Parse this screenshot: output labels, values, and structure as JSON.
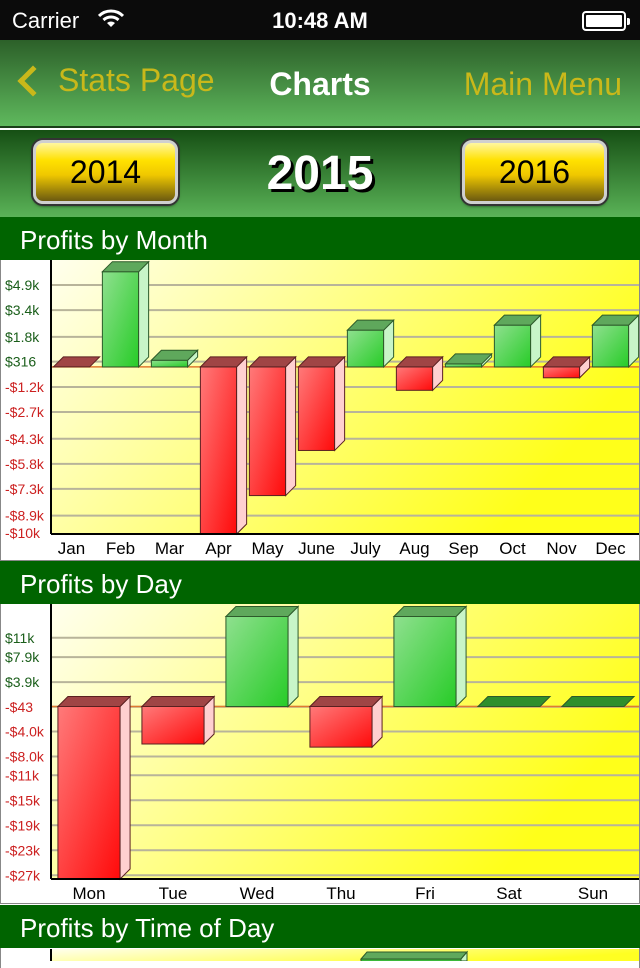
{
  "status_bar": {
    "carrier": "Carrier",
    "time": "10:48 AM"
  },
  "nav": {
    "back_label": "Stats Page",
    "title": "Charts",
    "right_label": "Main Menu"
  },
  "year_selector": {
    "prev": "2014",
    "current": "2015",
    "next": "2016"
  },
  "colors": {
    "header_green": "#006400",
    "positive_label": "#1a5e1a",
    "negative_label": "#cc2020",
    "accent_gold": "#c9b81a"
  },
  "sections": [
    {
      "title": "Profits by Month"
    },
    {
      "title": "Profits by Day"
    },
    {
      "title": "Profits by Time of Day"
    }
  ],
  "chart_data": [
    {
      "type": "bar",
      "title": "Profits by Month",
      "categories": [
        "Jan",
        "Feb",
        "Mar",
        "Apr",
        "May",
        "June",
        "July",
        "Aug",
        "Sep",
        "Oct",
        "Nov",
        "Dec"
      ],
      "values": [
        -10,
        5700,
        400,
        -10000,
        -7700,
        -5000,
        2200,
        -1400,
        180,
        2500,
        -650,
        2500
      ],
      "ytick_labels": [
        "$4.9k",
        "$3.4k",
        "$1.8k",
        "$316",
        "-$1.2k",
        "-$2.7k",
        "-$4.3k",
        "-$5.8k",
        "-$7.3k",
        "-$8.9k",
        "-$10k"
      ],
      "ytick_values": [
        4900,
        3400,
        1800,
        316,
        -1200,
        -2700,
        -4300,
        -5800,
        -7300,
        -8900,
        -10000
      ],
      "ylim": [
        -10000,
        6400
      ],
      "xlabel": "",
      "ylabel": "",
      "grid": true
    },
    {
      "type": "bar",
      "title": "Profits by Day",
      "categories": [
        "Mon",
        "Tue",
        "Wed",
        "Thu",
        "Fri",
        "Sat",
        "Sun"
      ],
      "values": [
        -27600,
        -6000,
        14400,
        -6500,
        14400,
        0,
        0
      ],
      "ytick_labels": [
        "$11k",
        "$7.9k",
        "$3.9k",
        "-$43",
        "-$4.0k",
        "-$8.0k",
        "-$11k",
        "-$15k",
        "-$19k",
        "-$23k",
        "-$27k"
      ],
      "ytick_values": [
        11000,
        7900,
        3900,
        -43,
        -4000,
        -8000,
        -11000,
        -15000,
        -19000,
        -23000,
        -27000
      ],
      "ylim": [
        -27600,
        16400
      ],
      "xlabel": "",
      "ylabel": "",
      "grid": true
    }
  ]
}
